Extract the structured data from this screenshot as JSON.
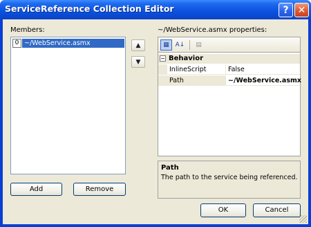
{
  "window": {
    "title": "ServiceReference Collection Editor",
    "help_glyph": "?",
    "close_glyph": "✕"
  },
  "members": {
    "label": "Members:",
    "items": [
      {
        "index": "0",
        "name": "~/WebService.asmx"
      }
    ],
    "move_up_glyph": "▲",
    "move_down_glyph": "▼",
    "add_label": "Add",
    "remove_label": "Remove"
  },
  "properties": {
    "label": "~/WebService.asmx properties:",
    "toolbar": {
      "categorized_glyph": "▦",
      "alphabetical_glyph": "A↓",
      "property_pages_glyph": "▤"
    },
    "category": {
      "toggle_glyph": "−",
      "name": "Behavior"
    },
    "rows": [
      {
        "name": "InlineScript",
        "value": "False"
      },
      {
        "name": "Path",
        "value": "~/WebService.asmx"
      }
    ],
    "description": {
      "title": "Path",
      "text": "The path to the service being referenced."
    }
  },
  "footer": {
    "ok_label": "OK",
    "cancel_label": "Cancel"
  }
}
